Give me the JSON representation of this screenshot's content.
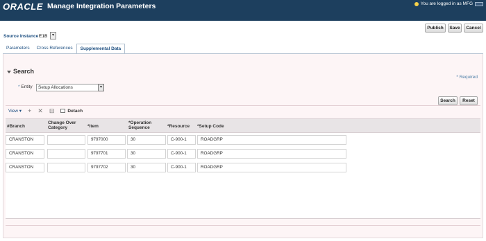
{
  "header": {
    "logo": "ORACLE",
    "title": "Manage Integration Parameters",
    "user_text": "You are logged in as MFG"
  },
  "actions": {
    "publish": "Publish",
    "save": "Save",
    "cancel": "Cancel"
  },
  "source": {
    "label": "Source Instance",
    "value": "E1B"
  },
  "tabs": [
    {
      "label": "Parameters",
      "active": false
    },
    {
      "label": "Cross References",
      "active": false
    },
    {
      "label": "Supplemental Data",
      "active": true
    }
  ],
  "search": {
    "title": "Search",
    "required": "* Required",
    "entity_label": "Entity",
    "entity_value": "Setup Allocations",
    "search_button": "Search",
    "reset_button": "Reset"
  },
  "toolbar": {
    "view": "View",
    "detach": "Detach"
  },
  "table": {
    "columns": [
      "#Branch",
      "Change Over Category",
      "*Item",
      "*Operation Sequence",
      "*Resource",
      "*Setup Code"
    ],
    "rows": [
      [
        "CRANSTON",
        "",
        "9797000",
        "30",
        "C-900-1",
        "ROADGRP"
      ],
      [
        "CRANSTON",
        "",
        "9797701",
        "30",
        "C-900-1",
        "ROADGRP"
      ],
      [
        "CRANSTON",
        "",
        "9797702",
        "30",
        "C-900-1",
        "ROADGRP"
      ]
    ]
  }
}
